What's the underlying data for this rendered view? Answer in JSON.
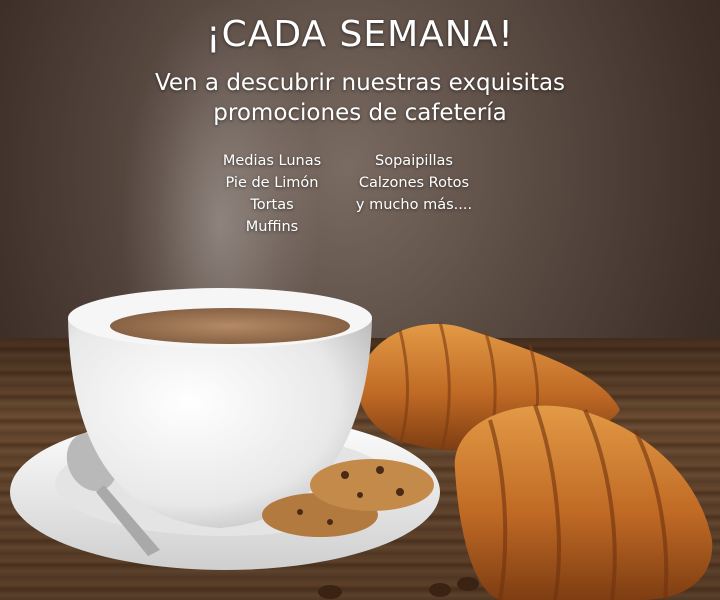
{
  "headline": "¡CADA SEMANA!",
  "subheadline": {
    "line1": "Ven a descubrir nuestras exquisitas",
    "line2": "promociones de cafetería"
  },
  "products_left": [
    "Medias Lunas",
    "Pie de Limón",
    "Tortas",
    "Muffins"
  ],
  "products_right": [
    "Sopaipillas",
    "Calzones Rotos",
    "y mucho más...."
  ],
  "colors": {
    "text": "#ffffff",
    "background": "#5a4b43",
    "table_wood": "#6b4a30",
    "croissant": "#c9752c",
    "cup": "#f2f2f2",
    "coffee": "#a27a58"
  }
}
